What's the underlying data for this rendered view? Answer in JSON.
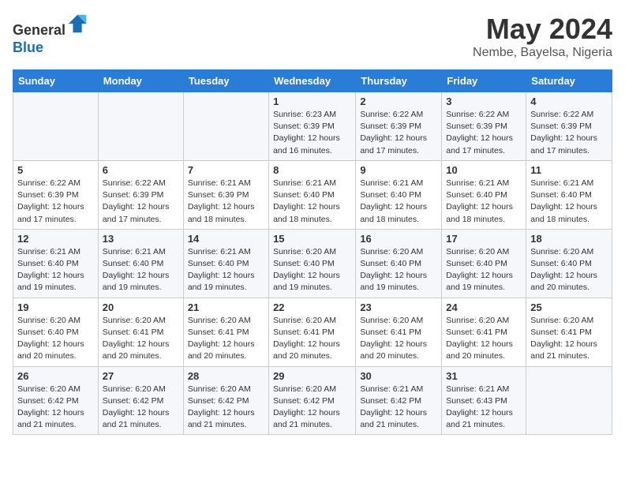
{
  "header": {
    "logo_line1": "General",
    "logo_line2": "Blue",
    "month_year": "May 2024",
    "location": "Nembe, Bayelsa, Nigeria"
  },
  "days_of_week": [
    "Sunday",
    "Monday",
    "Tuesday",
    "Wednesday",
    "Thursday",
    "Friday",
    "Saturday"
  ],
  "weeks": [
    [
      {
        "day": "",
        "info": ""
      },
      {
        "day": "",
        "info": ""
      },
      {
        "day": "",
        "info": ""
      },
      {
        "day": "1",
        "info": "Sunrise: 6:23 AM\nSunset: 6:39 PM\nDaylight: 12 hours and 16 minutes."
      },
      {
        "day": "2",
        "info": "Sunrise: 6:22 AM\nSunset: 6:39 PM\nDaylight: 12 hours and 17 minutes."
      },
      {
        "day": "3",
        "info": "Sunrise: 6:22 AM\nSunset: 6:39 PM\nDaylight: 12 hours and 17 minutes."
      },
      {
        "day": "4",
        "info": "Sunrise: 6:22 AM\nSunset: 6:39 PM\nDaylight: 12 hours and 17 minutes."
      }
    ],
    [
      {
        "day": "5",
        "info": "Sunrise: 6:22 AM\nSunset: 6:39 PM\nDaylight: 12 hours and 17 minutes."
      },
      {
        "day": "6",
        "info": "Sunrise: 6:22 AM\nSunset: 6:39 PM\nDaylight: 12 hours and 17 minutes."
      },
      {
        "day": "7",
        "info": "Sunrise: 6:21 AM\nSunset: 6:39 PM\nDaylight: 12 hours and 18 minutes."
      },
      {
        "day": "8",
        "info": "Sunrise: 6:21 AM\nSunset: 6:40 PM\nDaylight: 12 hours and 18 minutes."
      },
      {
        "day": "9",
        "info": "Sunrise: 6:21 AM\nSunset: 6:40 PM\nDaylight: 12 hours and 18 minutes."
      },
      {
        "day": "10",
        "info": "Sunrise: 6:21 AM\nSunset: 6:40 PM\nDaylight: 12 hours and 18 minutes."
      },
      {
        "day": "11",
        "info": "Sunrise: 6:21 AM\nSunset: 6:40 PM\nDaylight: 12 hours and 18 minutes."
      }
    ],
    [
      {
        "day": "12",
        "info": "Sunrise: 6:21 AM\nSunset: 6:40 PM\nDaylight: 12 hours and 19 minutes."
      },
      {
        "day": "13",
        "info": "Sunrise: 6:21 AM\nSunset: 6:40 PM\nDaylight: 12 hours and 19 minutes."
      },
      {
        "day": "14",
        "info": "Sunrise: 6:21 AM\nSunset: 6:40 PM\nDaylight: 12 hours and 19 minutes."
      },
      {
        "day": "15",
        "info": "Sunrise: 6:20 AM\nSunset: 6:40 PM\nDaylight: 12 hours and 19 minutes."
      },
      {
        "day": "16",
        "info": "Sunrise: 6:20 AM\nSunset: 6:40 PM\nDaylight: 12 hours and 19 minutes."
      },
      {
        "day": "17",
        "info": "Sunrise: 6:20 AM\nSunset: 6:40 PM\nDaylight: 12 hours and 19 minutes."
      },
      {
        "day": "18",
        "info": "Sunrise: 6:20 AM\nSunset: 6:40 PM\nDaylight: 12 hours and 20 minutes."
      }
    ],
    [
      {
        "day": "19",
        "info": "Sunrise: 6:20 AM\nSunset: 6:40 PM\nDaylight: 12 hours and 20 minutes."
      },
      {
        "day": "20",
        "info": "Sunrise: 6:20 AM\nSunset: 6:41 PM\nDaylight: 12 hours and 20 minutes."
      },
      {
        "day": "21",
        "info": "Sunrise: 6:20 AM\nSunset: 6:41 PM\nDaylight: 12 hours and 20 minutes."
      },
      {
        "day": "22",
        "info": "Sunrise: 6:20 AM\nSunset: 6:41 PM\nDaylight: 12 hours and 20 minutes."
      },
      {
        "day": "23",
        "info": "Sunrise: 6:20 AM\nSunset: 6:41 PM\nDaylight: 12 hours and 20 minutes."
      },
      {
        "day": "24",
        "info": "Sunrise: 6:20 AM\nSunset: 6:41 PM\nDaylight: 12 hours and 20 minutes."
      },
      {
        "day": "25",
        "info": "Sunrise: 6:20 AM\nSunset: 6:41 PM\nDaylight: 12 hours and 21 minutes."
      }
    ],
    [
      {
        "day": "26",
        "info": "Sunrise: 6:20 AM\nSunset: 6:42 PM\nDaylight: 12 hours and 21 minutes."
      },
      {
        "day": "27",
        "info": "Sunrise: 6:20 AM\nSunset: 6:42 PM\nDaylight: 12 hours and 21 minutes."
      },
      {
        "day": "28",
        "info": "Sunrise: 6:20 AM\nSunset: 6:42 PM\nDaylight: 12 hours and 21 minutes."
      },
      {
        "day": "29",
        "info": "Sunrise: 6:20 AM\nSunset: 6:42 PM\nDaylight: 12 hours and 21 minutes."
      },
      {
        "day": "30",
        "info": "Sunrise: 6:21 AM\nSunset: 6:42 PM\nDaylight: 12 hours and 21 minutes."
      },
      {
        "day": "31",
        "info": "Sunrise: 6:21 AM\nSunset: 6:43 PM\nDaylight: 12 hours and 21 minutes."
      },
      {
        "day": "",
        "info": ""
      }
    ]
  ]
}
